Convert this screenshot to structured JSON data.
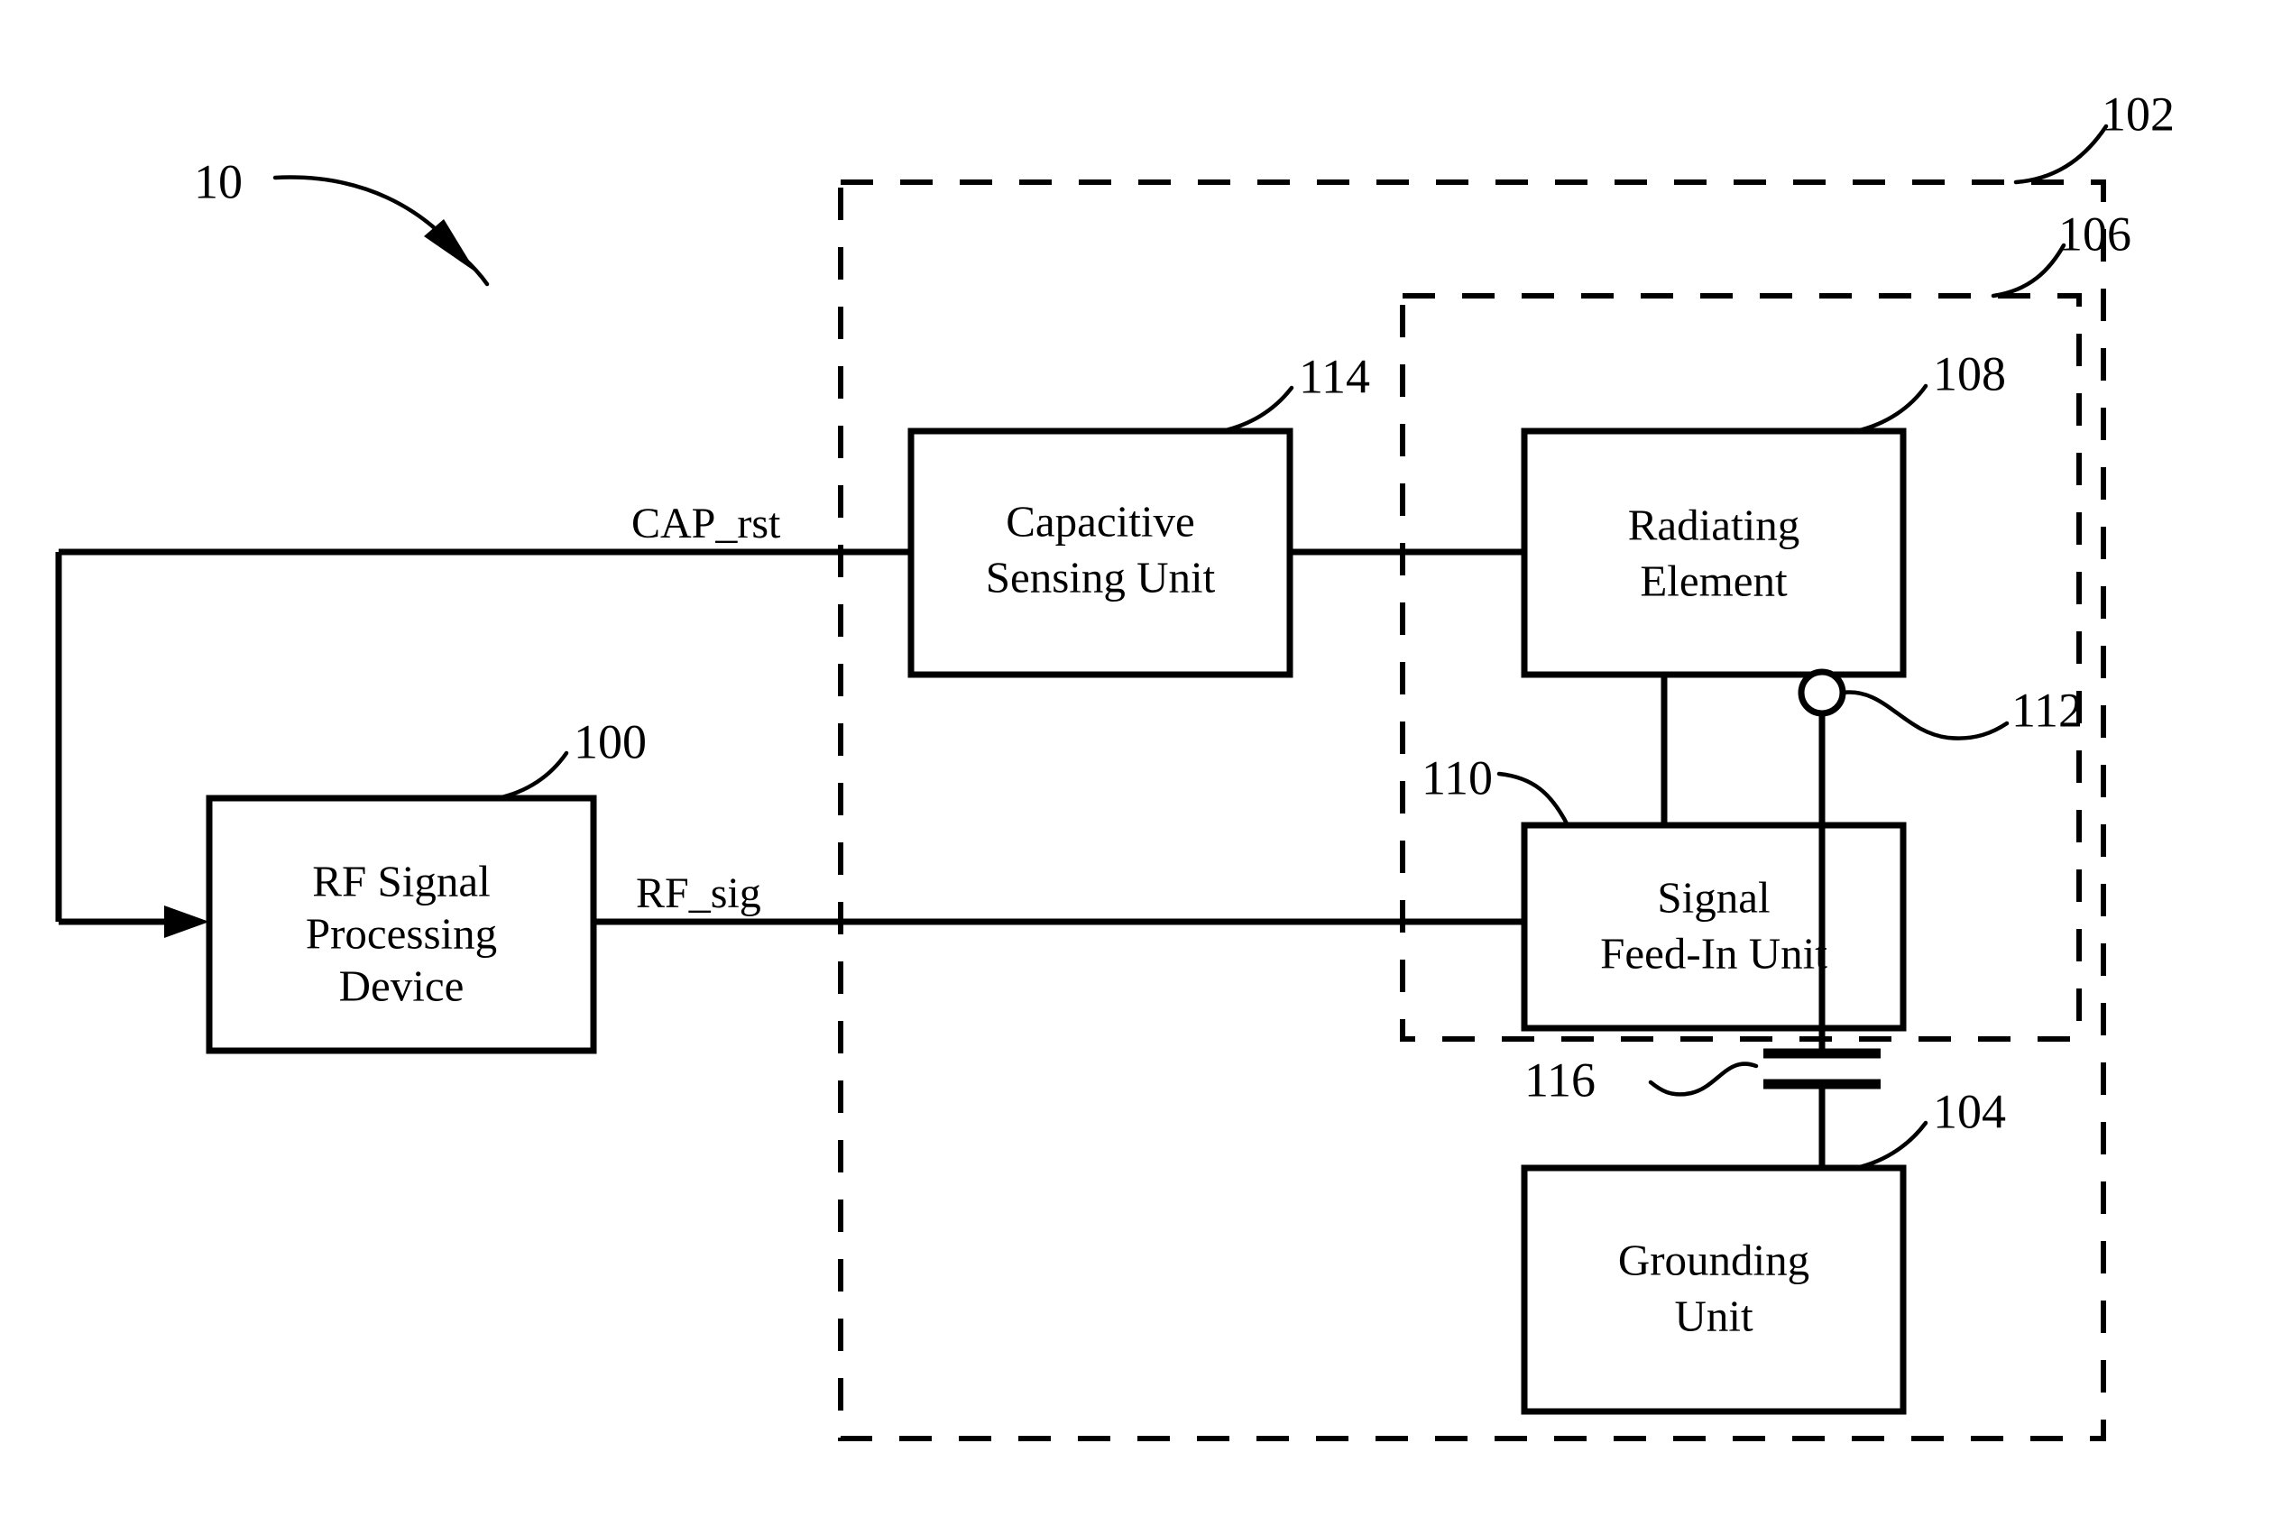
{
  "figure": {
    "type": "patent-block-diagram",
    "background_color": "#ffffff",
    "line_color": "#000000",
    "system_ref": "10"
  },
  "blocks": {
    "rf_signal_processing_device": {
      "line1": "RF Signal",
      "line2": "Processing",
      "line3": "Device",
      "ref": "100"
    },
    "capacitive_sensing_unit": {
      "line1": "Capacitive",
      "line2": "Sensing Unit",
      "ref": "114"
    },
    "radiating_element": {
      "line1": "Radiating",
      "line2": "Element",
      "ref": "108"
    },
    "signal_feed_in_unit": {
      "line1": "Signal",
      "line2": "Feed-In Unit",
      "ref": "110"
    },
    "grounding_unit": {
      "line1": "Grounding",
      "line2": "Unit",
      "ref": "104"
    }
  },
  "dashed_groups": {
    "outer_antenna_system": {
      "ref": "102"
    },
    "inner_antenna_module": {
      "ref": "106"
    }
  },
  "components": {
    "coupling_node": {
      "ref": "112",
      "shape": "circle-junction"
    },
    "capacitor": {
      "ref": "116",
      "shape": "two-plate-capacitor"
    }
  },
  "signals": {
    "cap_rst": "CAP_rst",
    "rf_sig": "RF_sig"
  },
  "reference_numerals": {
    "n10": "10",
    "n100": "100",
    "n102": "102",
    "n104": "104",
    "n106": "106",
    "n108": "108",
    "n110": "110",
    "n112": "112",
    "n114": "114",
    "n116": "116"
  }
}
